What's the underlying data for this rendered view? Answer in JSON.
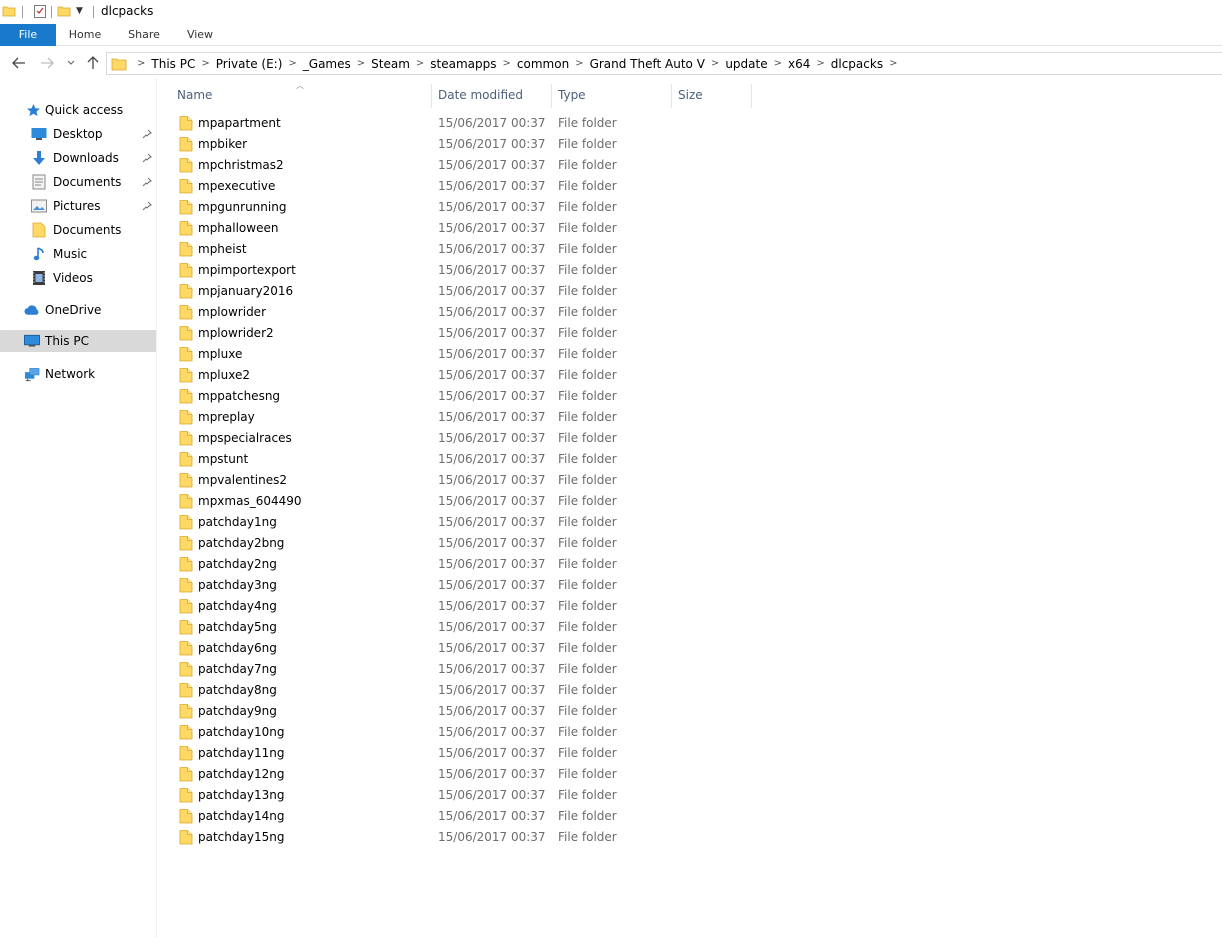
{
  "window": {
    "title": "dlcpacks"
  },
  "ribbon": {
    "tabs": [
      "File",
      "Home",
      "Share",
      "View"
    ]
  },
  "address": {
    "crumbs": [
      "This PC",
      "Private (E:)",
      "_Games",
      "Steam",
      "steamapps",
      "common",
      "Grand Theft Auto V",
      "update",
      "x64",
      "dlcpacks"
    ]
  },
  "sidebar": {
    "quick_access": "Quick access",
    "items": [
      {
        "label": "Desktop",
        "icon": "desktop-icon",
        "pinned": true
      },
      {
        "label": "Downloads",
        "icon": "downloads-icon",
        "pinned": true
      },
      {
        "label": "Documents",
        "icon": "documents-icon",
        "pinned": true
      },
      {
        "label": "Pictures",
        "icon": "pictures-icon",
        "pinned": true
      },
      {
        "label": "Documents",
        "icon": "folder-icon",
        "pinned": false
      },
      {
        "label": "Music",
        "icon": "music-icon",
        "pinned": false
      },
      {
        "label": "Videos",
        "icon": "videos-icon",
        "pinned": false
      }
    ],
    "onedrive": "OneDrive",
    "this_pc": "This PC",
    "network": "Network"
  },
  "columns": {
    "name": "Name",
    "date": "Date modified",
    "type": "Type",
    "size": "Size"
  },
  "files": [
    {
      "name": "mpapartment",
      "date": "15/06/2017 00:37",
      "type": "File folder"
    },
    {
      "name": "mpbiker",
      "date": "15/06/2017 00:37",
      "type": "File folder"
    },
    {
      "name": "mpchristmas2",
      "date": "15/06/2017 00:37",
      "type": "File folder"
    },
    {
      "name": "mpexecutive",
      "date": "15/06/2017 00:37",
      "type": "File folder"
    },
    {
      "name": "mpgunrunning",
      "date": "15/06/2017 00:37",
      "type": "File folder"
    },
    {
      "name": "mphalloween",
      "date": "15/06/2017 00:37",
      "type": "File folder"
    },
    {
      "name": "mpheist",
      "date": "15/06/2017 00:37",
      "type": "File folder"
    },
    {
      "name": "mpimportexport",
      "date": "15/06/2017 00:37",
      "type": "File folder"
    },
    {
      "name": "mpjanuary2016",
      "date": "15/06/2017 00:37",
      "type": "File folder"
    },
    {
      "name": "mplowrider",
      "date": "15/06/2017 00:37",
      "type": "File folder"
    },
    {
      "name": "mplowrider2",
      "date": "15/06/2017 00:37",
      "type": "File folder"
    },
    {
      "name": "mpluxe",
      "date": "15/06/2017 00:37",
      "type": "File folder"
    },
    {
      "name": "mpluxe2",
      "date": "15/06/2017 00:37",
      "type": "File folder"
    },
    {
      "name": "mppatchesng",
      "date": "15/06/2017 00:37",
      "type": "File folder"
    },
    {
      "name": "mpreplay",
      "date": "15/06/2017 00:37",
      "type": "File folder"
    },
    {
      "name": "mpspecialraces",
      "date": "15/06/2017 00:37",
      "type": "File folder"
    },
    {
      "name": "mpstunt",
      "date": "15/06/2017 00:37",
      "type": "File folder"
    },
    {
      "name": "mpvalentines2",
      "date": "15/06/2017 00:37",
      "type": "File folder"
    },
    {
      "name": "mpxmas_604490",
      "date": "15/06/2017 00:37",
      "type": "File folder"
    },
    {
      "name": "patchday1ng",
      "date": "15/06/2017 00:37",
      "type": "File folder"
    },
    {
      "name": "patchday2bng",
      "date": "15/06/2017 00:37",
      "type": "File folder"
    },
    {
      "name": "patchday2ng",
      "date": "15/06/2017 00:37",
      "type": "File folder"
    },
    {
      "name": "patchday3ng",
      "date": "15/06/2017 00:37",
      "type": "File folder"
    },
    {
      "name": "patchday4ng",
      "date": "15/06/2017 00:37",
      "type": "File folder"
    },
    {
      "name": "patchday5ng",
      "date": "15/06/2017 00:37",
      "type": "File folder"
    },
    {
      "name": "patchday6ng",
      "date": "15/06/2017 00:37",
      "type": "File folder"
    },
    {
      "name": "patchday7ng",
      "date": "15/06/2017 00:37",
      "type": "File folder"
    },
    {
      "name": "patchday8ng",
      "date": "15/06/2017 00:37",
      "type": "File folder"
    },
    {
      "name": "patchday9ng",
      "date": "15/06/2017 00:37",
      "type": "File folder"
    },
    {
      "name": "patchday10ng",
      "date": "15/06/2017 00:37",
      "type": "File folder"
    },
    {
      "name": "patchday11ng",
      "date": "15/06/2017 00:37",
      "type": "File folder"
    },
    {
      "name": "patchday12ng",
      "date": "15/06/2017 00:37",
      "type": "File folder"
    },
    {
      "name": "patchday13ng",
      "date": "15/06/2017 00:37",
      "type": "File folder"
    },
    {
      "name": "patchday14ng",
      "date": "15/06/2017 00:37",
      "type": "File folder"
    },
    {
      "name": "patchday15ng",
      "date": "15/06/2017 00:37",
      "type": "File folder"
    }
  ],
  "colors": {
    "file_tab": "#1979ca",
    "selected_nav": "#d9d9d9",
    "column_header": "#4c607a",
    "folder_yellow": "#ffd865",
    "secondary_text": "#6d6d6d"
  }
}
